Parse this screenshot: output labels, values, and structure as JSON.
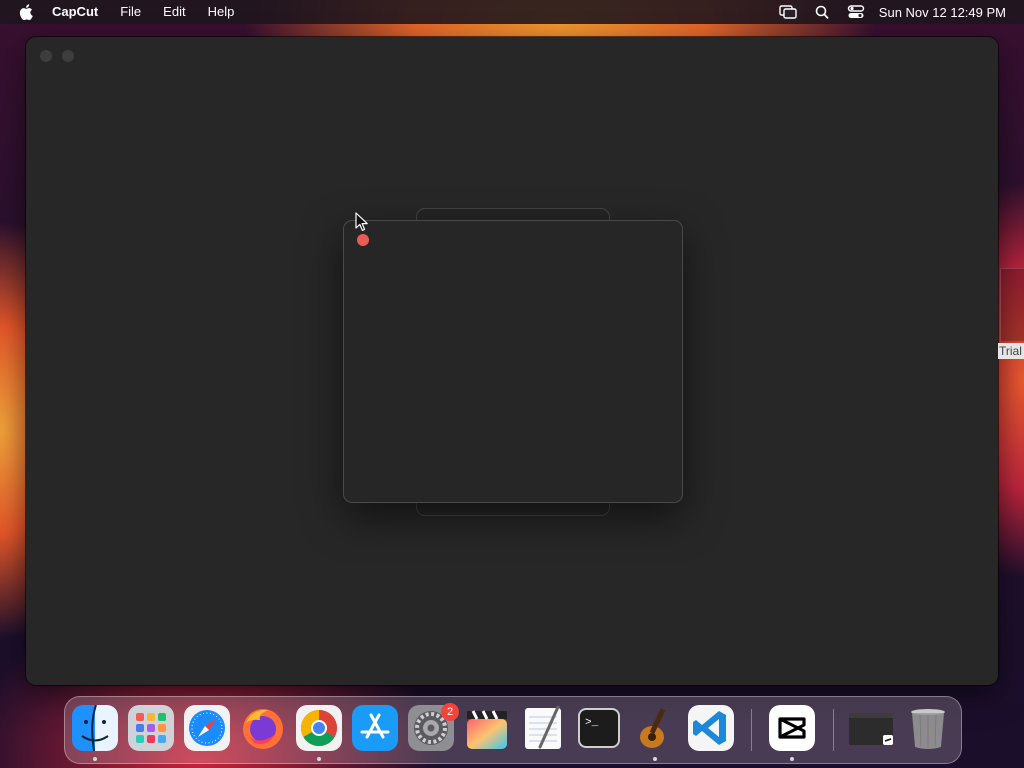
{
  "menubar": {
    "app_name": "CapCut",
    "menus": [
      "File",
      "Edit",
      "Help"
    ],
    "clock": "Sun Nov 12  12:49 PM",
    "status_icons": [
      "screen-mirroring-icon",
      "spotlight-search-icon",
      "control-center-icon"
    ]
  },
  "side_panel": {
    "label": "Trial"
  },
  "dock": {
    "items": [
      {
        "name": "Finder",
        "icon": "finder-icon",
        "running": true
      },
      {
        "name": "Launchpad",
        "icon": "launchpad-icon",
        "running": false
      },
      {
        "name": "Safari",
        "icon": "safari-icon",
        "running": false
      },
      {
        "name": "Firefox",
        "icon": "firefox-icon",
        "running": false
      },
      {
        "name": "Google Chrome",
        "icon": "chrome-icon",
        "running": true
      },
      {
        "name": "App Store",
        "icon": "app-store-icon",
        "running": false
      },
      {
        "name": "System Settings",
        "icon": "system-settings-icon",
        "running": false,
        "badge": "2"
      },
      {
        "name": "Final Cut Pro",
        "icon": "final-cut-pro-icon",
        "running": false
      },
      {
        "name": "TextEdit",
        "icon": "textedit-icon",
        "running": false
      },
      {
        "name": "Terminal",
        "icon": "terminal-icon",
        "running": false
      },
      {
        "name": "GarageBand",
        "icon": "garageband-icon",
        "running": true
      },
      {
        "name": "Visual Studio Code",
        "icon": "vscode-icon",
        "running": false
      },
      {
        "name": "CapCut",
        "icon": "capcut-icon",
        "running": true
      },
      {
        "name": "Recent window",
        "icon": "window-thumbnail-icon",
        "running": false
      },
      {
        "name": "Trash",
        "icon": "trash-icon",
        "running": false
      }
    ]
  },
  "colors": {
    "window_bg": "#272727",
    "dialog_bg": "#262626",
    "close_button": "#ec5a55",
    "badge": "#f2443b"
  }
}
